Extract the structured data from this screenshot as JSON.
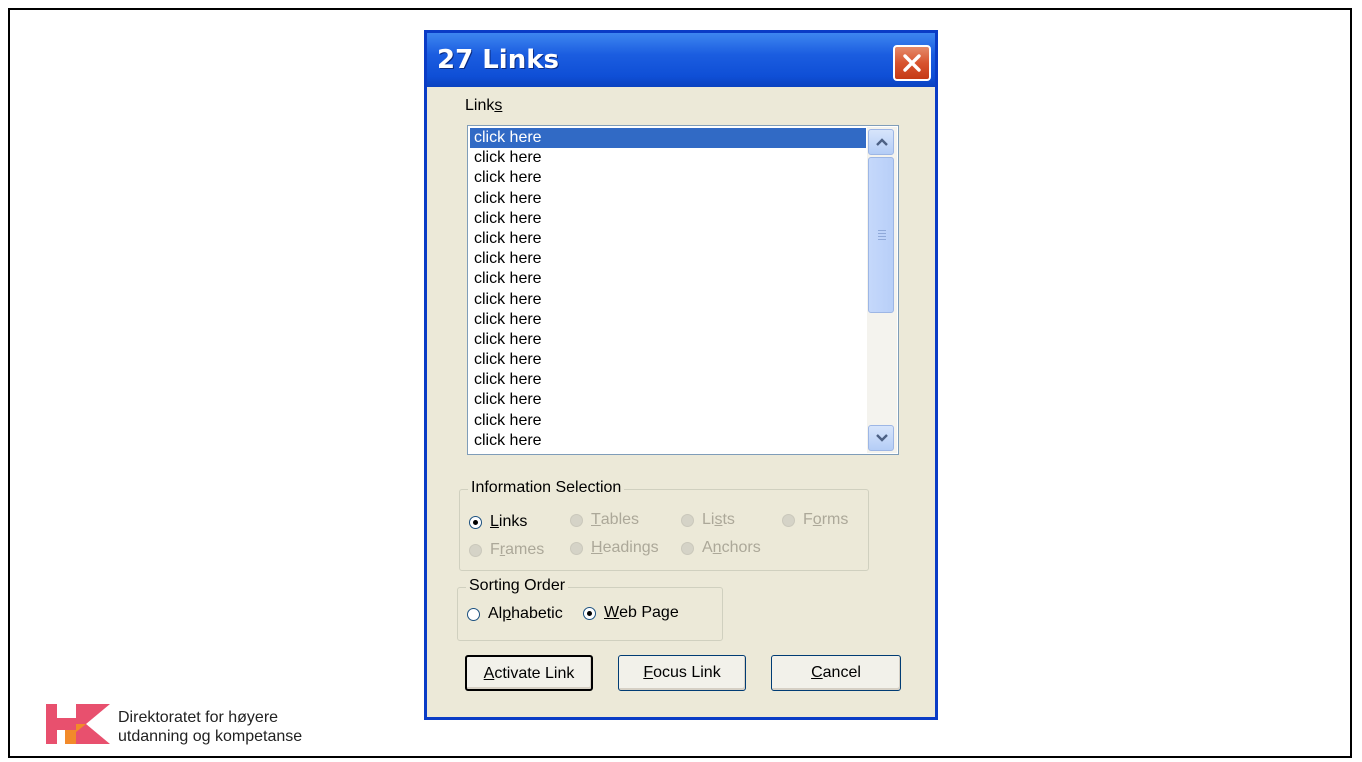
{
  "dialog": {
    "title": "27 Links",
    "close_label": "close",
    "list_label": {
      "pre": "Link",
      "acc": "s",
      "post": ""
    },
    "links": [
      "click here",
      "click here",
      "click here",
      "click here",
      "click here",
      "click here",
      "click here",
      "click here",
      "click here",
      "click here",
      "click here",
      "click here",
      "click here",
      "click here",
      "click here",
      "click here"
    ],
    "info_group": "Information Selection",
    "info_options": [
      {
        "pre": "",
        "acc": "L",
        "post": "inks",
        "selected": true,
        "enabled": true
      },
      {
        "pre": "",
        "acc": "T",
        "post": "ables",
        "selected": false,
        "enabled": false
      },
      {
        "pre": "Li",
        "acc": "s",
        "post": "ts",
        "selected": false,
        "enabled": false
      },
      {
        "pre": "F",
        "acc": "o",
        "post": "rms",
        "selected": false,
        "enabled": false
      },
      {
        "pre": "F",
        "acc": "r",
        "post": "ames",
        "selected": false,
        "enabled": false
      },
      {
        "pre": "",
        "acc": "H",
        "post": "eadings",
        "selected": false,
        "enabled": false
      },
      {
        "pre": "A",
        "acc": "n",
        "post": "chors",
        "selected": false,
        "enabled": false
      }
    ],
    "sort_group": "Sorting Order",
    "sort_options": [
      {
        "pre": "Al",
        "acc": "p",
        "post": "habetic",
        "selected": false
      },
      {
        "pre": "",
        "acc": "W",
        "post": "eb Page",
        "selected": true
      }
    ],
    "buttons": {
      "activate": {
        "pre": "",
        "acc": "A",
        "post": "ctivate Link"
      },
      "focus": {
        "pre": "",
        "acc": "F",
        "post": "ocus Link"
      },
      "cancel": {
        "pre": "",
        "acc": "C",
        "post": "ancel"
      }
    }
  },
  "footer": {
    "org_line1": "Direktoratet for høyere",
    "org_line2": "utdanning og kompetanse"
  },
  "colors": {
    "title_bar": "#0F4FD6",
    "selection": "#316AC5",
    "logo_pink": "#E8506E",
    "logo_orange": "#F28A2A"
  }
}
